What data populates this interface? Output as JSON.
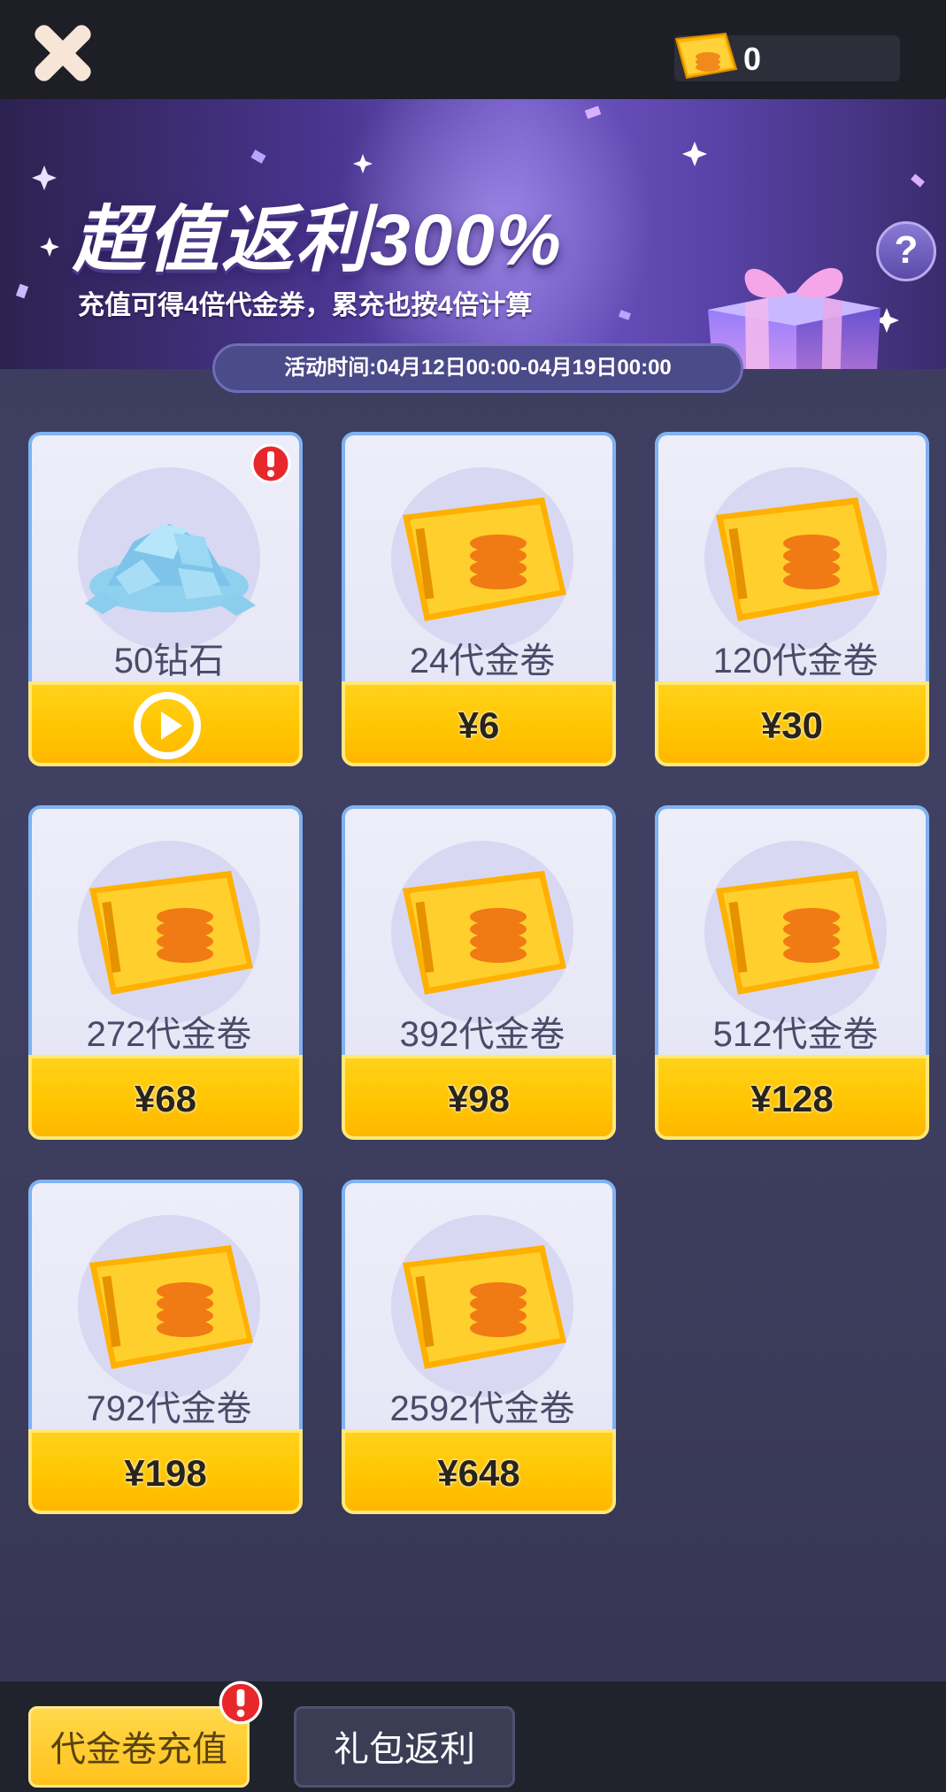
{
  "header": {
    "currency_value": "0"
  },
  "banner": {
    "title": "超值返利300%",
    "subtitle": "充值可得4倍代金券，累充也按4倍计算",
    "help_label": "?",
    "event_time": "活动时间:04月12日00:00-04月19日00:00"
  },
  "items": [
    {
      "label": "50钻石",
      "price": "",
      "type": "diamond",
      "action": "play-video"
    },
    {
      "label": "24代金卷",
      "price": "¥6",
      "type": "voucher"
    },
    {
      "label": "120代金卷",
      "price": "¥30",
      "type": "voucher"
    },
    {
      "label": "272代金卷",
      "price": "¥68",
      "type": "voucher"
    },
    {
      "label": "392代金卷",
      "price": "¥98",
      "type": "voucher"
    },
    {
      "label": "512代金卷",
      "price": "¥128",
      "type": "voucher"
    },
    {
      "label": "792代金卷",
      "price": "¥198",
      "type": "voucher"
    },
    {
      "label": "2592代金卷",
      "price": "¥648",
      "type": "voucher"
    }
  ],
  "tabs": [
    {
      "label": "代金卷充值",
      "active": true
    },
    {
      "label": "礼包返利",
      "active": false
    }
  ],
  "colors": {
    "accent_yellow": "#ffc400",
    "card_border": "#7fb2f2",
    "alert_red": "#e8272b",
    "banner_purple": "#5a43a8"
  }
}
